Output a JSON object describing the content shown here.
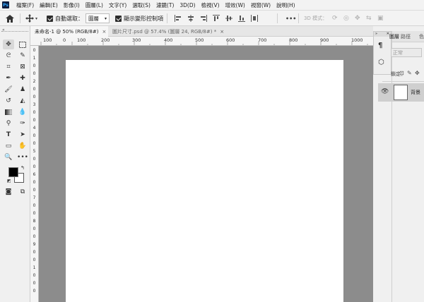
{
  "app": {
    "logo": "Ps"
  },
  "menu": [
    "檔案(F)",
    "編輯(E)",
    "影像(I)",
    "圖層(L)",
    "文字(Y)",
    "選取(S)",
    "濾鏡(T)",
    "3D(D)",
    "檢視(V)",
    "增效(W)",
    "視窗(W)",
    "說明(H)"
  ],
  "options": {
    "auto_select_label": "自動選取：",
    "auto_select_target": "圖層",
    "show_transform_label": "顯示變形控制項",
    "mode_3d_label": "3D 模式：",
    "more": "•••"
  },
  "tabs": [
    {
      "label": "未命名-1 @ 50% (RGB/8#)",
      "close": "×"
    },
    {
      "label": "圖片尺寸.psd @ 57.4% (圖層 24, RGB/8#) *",
      "close": "×"
    }
  ],
  "ruler": {
    "top": [
      "100",
      "0",
      "100",
      "200",
      "300",
      "400",
      "500",
      "600",
      "700",
      "800",
      "900",
      "1000",
      "1100",
      "1200"
    ],
    "left": [
      "0",
      "1",
      "0",
      "0",
      "2",
      "0",
      "0",
      "3",
      "0",
      "0",
      "4",
      "0",
      "0",
      "5",
      "0",
      "0",
      "6",
      "0",
      "0",
      "7",
      "0",
      "0",
      "8",
      "0",
      "0",
      "9",
      "0",
      "0",
      "1",
      "0",
      "0",
      "0"
    ]
  },
  "right_panel": {
    "tabs": [
      "圖層",
      "路徑",
      "色"
    ],
    "blend": "正常",
    "lock_label": "鎖定：",
    "layer_name": "背景"
  },
  "colors": {
    "canvas_bg": "#8c8c8c",
    "document": "#ffffff",
    "foreground": "#000000",
    "background": "#ffffff"
  }
}
